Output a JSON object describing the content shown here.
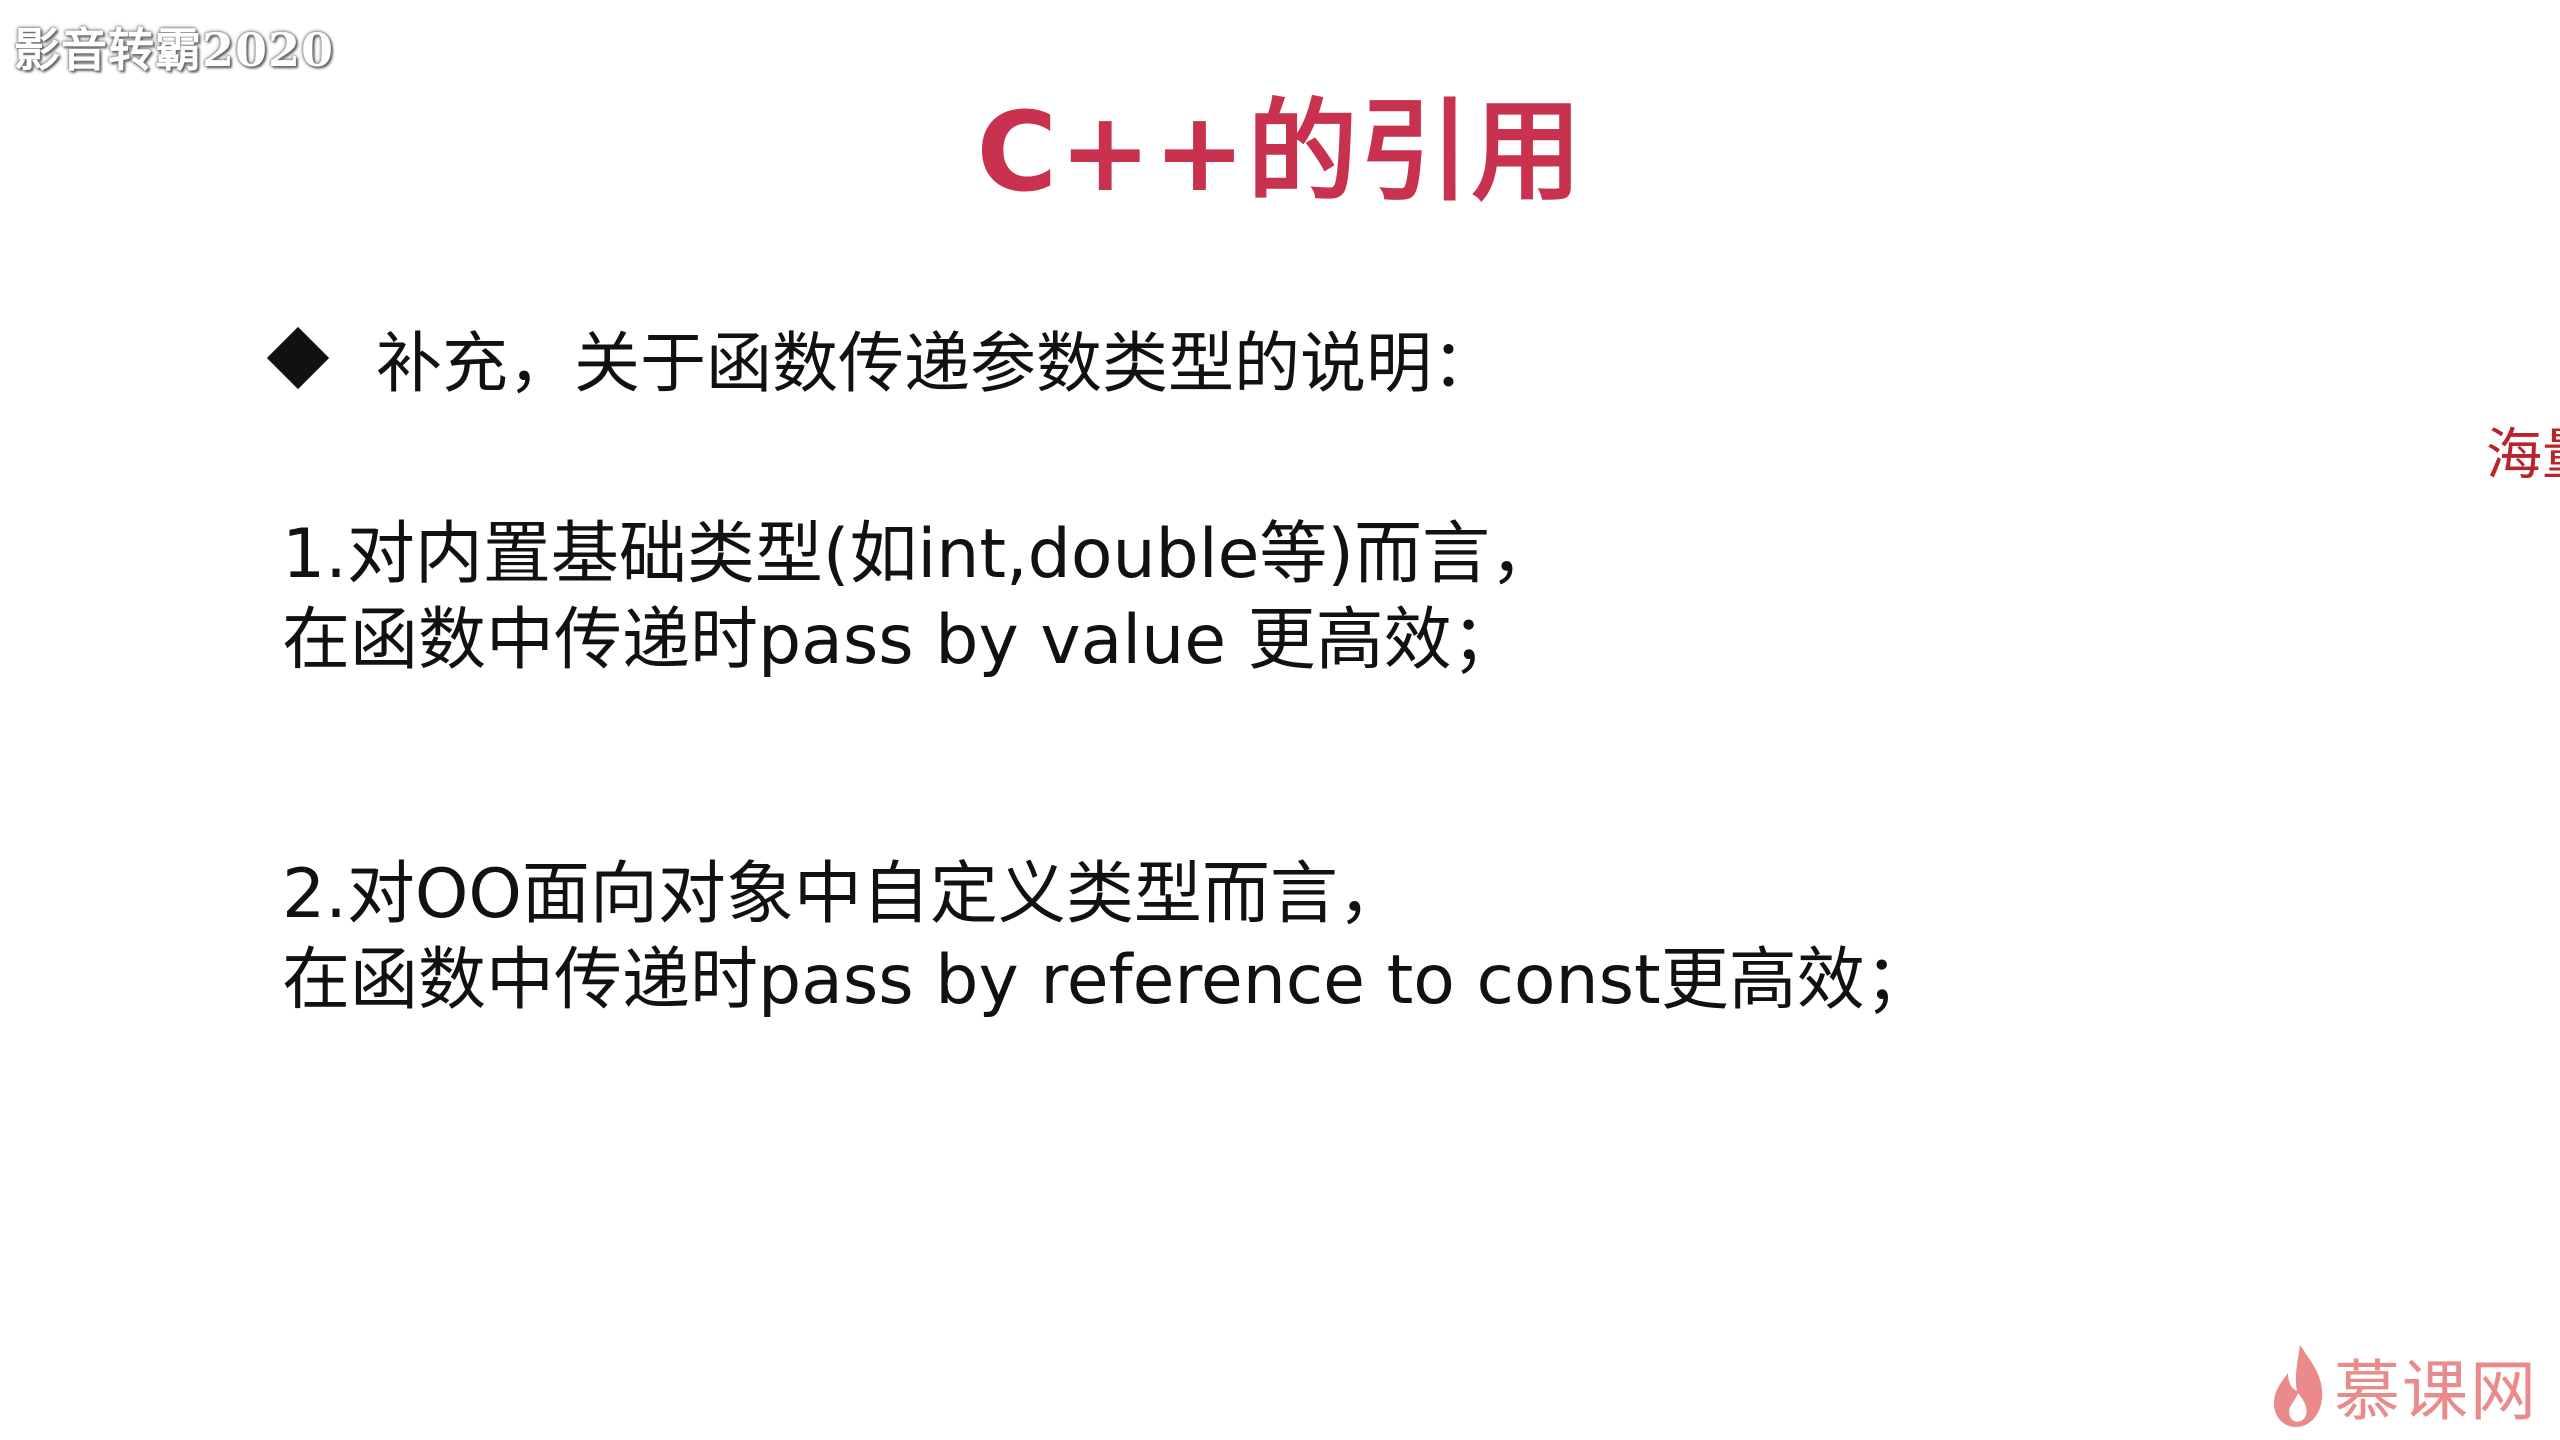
{
  "watermark": {
    "text": "影音转霸2020"
  },
  "slide": {
    "title": "C++的引用",
    "bullet": "补充，关于函数传递参数类型的说明：",
    "points": [
      {
        "line1": "1.对内置基础类型(如int,double等)而言，",
        "line2": "在函数中传递时pass by value 更高效；"
      },
      {
        "line1": "2.对OO面向对象中自定义类型而言，",
        "line2": "在函数中传递时pass by reference to const更高效；"
      }
    ]
  },
  "side_note": {
    "text": "海量"
  },
  "brand": {
    "text": "慕课网",
    "icon": "flame-icon"
  },
  "colors": {
    "title": "#c8324e",
    "side_note": "#b8242c",
    "brand": "#ea8a8a"
  }
}
